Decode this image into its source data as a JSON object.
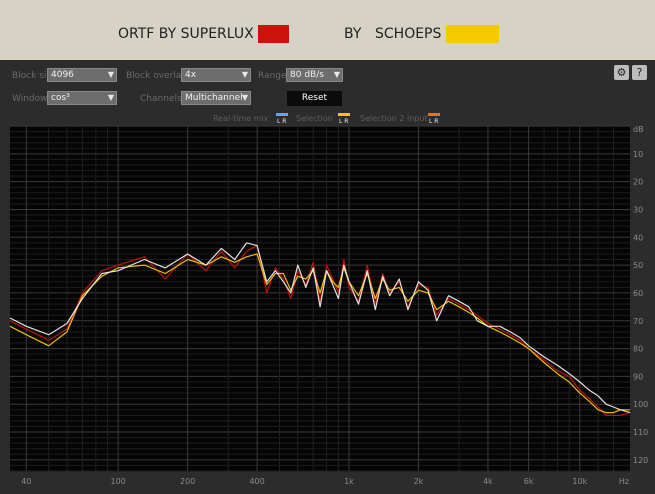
{
  "legend": {
    "item1_label": "ORTF BY SUPERLUX",
    "item1_color": "#c8140a",
    "by_label": "BY",
    "item2_label": "SCHOEPS",
    "item2_color": "#f5c800"
  },
  "controls": {
    "block_size_label": "Block size",
    "block_size_value": "4096",
    "overlap_label": "Block overlap",
    "overlap_value": "4x",
    "range_label": "Range",
    "range_value": "80 dB/s",
    "window_label": "Window",
    "window_value": "cos³",
    "channels_label": "Channels",
    "channels_value": "Multichannel",
    "reset_label": "Reset",
    "settings_icon": "gear-icon",
    "help_label": "?"
  },
  "series_tags": {
    "tag1": "Real-time mix",
    "tag2": "Selection",
    "tag3": "Selection 2 input",
    "lr": "L R"
  },
  "chart_data": {
    "type": "line",
    "title": "",
    "xlabel": "Hz",
    "ylabel": "dB",
    "x_scale": "log",
    "xlim": [
      34,
      16500
    ],
    "ylim": [
      -124,
      0
    ],
    "x_ticks": [
      {
        "v": 40,
        "label": "40"
      },
      {
        "v": 100,
        "label": "100"
      },
      {
        "v": 200,
        "label": "200"
      },
      {
        "v": 400,
        "label": "400"
      },
      {
        "v": 1000,
        "label": "1k"
      },
      {
        "v": 2000,
        "label": "2k"
      },
      {
        "v": 4000,
        "label": "4k"
      },
      {
        "v": 6000,
        "label": "6k"
      },
      {
        "v": 10000,
        "label": "10k"
      }
    ],
    "x_minor_ticks": [
      50,
      60,
      70,
      80,
      90,
      300,
      500,
      600,
      700,
      800,
      900,
      3000,
      5000,
      7000,
      8000,
      9000,
      12000,
      14000
    ],
    "y_ticks": [
      -10,
      -20,
      -30,
      -40,
      -50,
      -60,
      -70,
      -80,
      -90,
      -100,
      -110,
      -120
    ],
    "y_tick_labels": [
      "10",
      "20",
      "30",
      "40",
      "50",
      "60",
      "70",
      "80",
      "90",
      "100",
      "110",
      "120"
    ],
    "series": [
      {
        "color": "#c8140a",
        "x": [
          34,
          40,
          50,
          60,
          70,
          85,
          100,
          130,
          160,
          200,
          240,
          280,
          320,
          360,
          400,
          440,
          480,
          520,
          560,
          600,
          650,
          700,
          750,
          800,
          850,
          900,
          950,
          1000,
          1100,
          1200,
          1300,
          1400,
          1500,
          1650,
          1800,
          2000,
          2200,
          2400,
          2700,
          3000,
          3300,
          3600,
          4000,
          4500,
          5000,
          5500,
          6000,
          7000,
          8000,
          9000,
          10000,
          11000,
          12000,
          13000,
          14000,
          15000,
          16500
        ],
        "y": [
          -70,
          -73,
          -77,
          -73,
          -60,
          -52,
          -50,
          -47,
          -55,
          -46,
          -52,
          -45,
          -51,
          -45,
          -43,
          -60,
          -51,
          -55,
          -62,
          -52,
          -57,
          -49,
          -63,
          -50,
          -55,
          -60,
          -48,
          -58,
          -63,
          -50,
          -64,
          -53,
          -60,
          -56,
          -65,
          -57,
          -58,
          -68,
          -62,
          -64,
          -66,
          -68,
          -71,
          -73,
          -75,
          -77,
          -80,
          -84,
          -88,
          -90,
          -95,
          -98,
          -101,
          -104,
          -104,
          -104,
          -103
        ]
      },
      {
        "color": "#f5c800",
        "x": [
          34,
          40,
          50,
          60,
          70,
          85,
          100,
          130,
          160,
          200,
          240,
          280,
          320,
          360,
          400,
          440,
          480,
          520,
          560,
          600,
          650,
          700,
          750,
          800,
          850,
          900,
          950,
          1000,
          1100,
          1200,
          1300,
          1400,
          1500,
          1650,
          1800,
          2000,
          2200,
          2400,
          2700,
          3000,
          3300,
          3600,
          4000,
          4500,
          5000,
          5500,
          6000,
          7000,
          8000,
          9000,
          10000,
          11000,
          12000,
          13000,
          14000,
          15000,
          16500
        ],
        "y": [
          -72,
          -75,
          -79,
          -74,
          -61,
          -54,
          -51,
          -50,
          -53,
          -48,
          -50,
          -47,
          -49,
          -47,
          -46,
          -57,
          -53,
          -53,
          -59,
          -54,
          -55,
          -52,
          -60,
          -52,
          -56,
          -58,
          -51,
          -56,
          -61,
          -53,
          -62,
          -55,
          -59,
          -58,
          -63,
          -59,
          -60,
          -66,
          -63,
          -65,
          -67,
          -69,
          -72,
          -74,
          -76,
          -78,
          -80,
          -85,
          -89,
          -92,
          -96,
          -99,
          -102,
          -103,
          -103,
          -102,
          -102
        ]
      },
      {
        "color": "#eeeeee",
        "x": [
          34,
          40,
          50,
          60,
          70,
          85,
          100,
          130,
          160,
          200,
          240,
          280,
          320,
          360,
          400,
          440,
          480,
          520,
          560,
          600,
          650,
          700,
          750,
          800,
          850,
          900,
          950,
          1000,
          1100,
          1200,
          1300,
          1400,
          1500,
          1650,
          1800,
          2000,
          2200,
          2400,
          2700,
          3000,
          3300,
          3600,
          4000,
          4500,
          5000,
          5500,
          6000,
          7000,
          8000,
          9000,
          10000,
          11000,
          12000,
          13000,
          14000,
          15000,
          16500
        ],
        "y": [
          -69,
          -72,
          -75,
          -71,
          -62,
          -53,
          -52,
          -48,
          -51,
          -46,
          -50,
          -44,
          -48,
          -42,
          -43,
          -56,
          -52,
          -56,
          -60,
          -50,
          -58,
          -51,
          -65,
          -52,
          -57,
          -62,
          -50,
          -56,
          -64,
          -52,
          -66,
          -54,
          -61,
          -55,
          -66,
          -56,
          -59,
          -70,
          -61,
          -63,
          -65,
          -70,
          -72,
          -72,
          -74,
          -76,
          -79,
          -83,
          -86,
          -89,
          -92,
          -95,
          -97,
          -100,
          -101,
          -102,
          -103
        ]
      }
    ]
  }
}
